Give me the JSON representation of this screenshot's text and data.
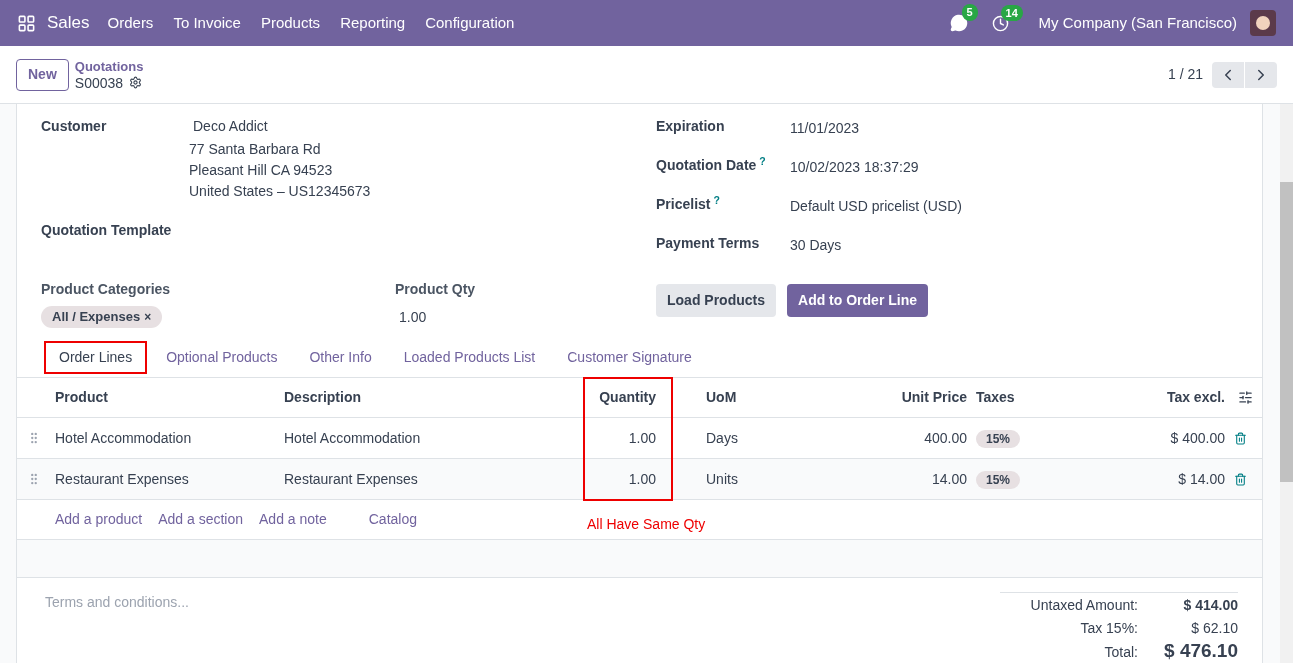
{
  "navbar": {
    "app": "Sales",
    "menu": [
      "Orders",
      "To Invoice",
      "Products",
      "Reporting",
      "Configuration"
    ],
    "messages_count": "5",
    "activities_count": "14",
    "company": "My Company (San Francisco)"
  },
  "control_panel": {
    "new_button": "New",
    "breadcrumb": "Quotations",
    "record": "S00038",
    "pager": "1 / 21"
  },
  "form": {
    "left_fields": [
      {
        "label": "Customer",
        "lines": [
          "Deco Addict",
          "77 Santa Barbara Rd",
          "Pleasant Hill CA 94523",
          "United States – US12345673"
        ]
      },
      {
        "label": "Quotation Template"
      }
    ],
    "right_fields": [
      {
        "label": "Expiration",
        "value": "11/01/2023"
      },
      {
        "label": "Quotation Date",
        "help": "?",
        "value": "10/02/2023 18:37:29"
      },
      {
        "label": "Pricelist",
        "help": "?",
        "value": "Default USD pricelist (USD)"
      },
      {
        "label": "Payment Terms",
        "value": "30 Days"
      }
    ],
    "product_categories": {
      "label": "Product Categories",
      "tags": [
        {
          "label": "All / Expenses",
          "remove": "×"
        }
      ]
    },
    "product_qty": {
      "label": "Product Qty",
      "value": "1.00"
    },
    "buttons": [
      {
        "label": "Load Products",
        "kind": "secondary"
      },
      {
        "label": "Add to Order Line",
        "kind": "primary"
      }
    ]
  },
  "tabs": [
    {
      "label": "Order Lines",
      "selected": true
    },
    {
      "label": "Optional Products",
      "selected": false
    },
    {
      "label": "Other Info",
      "selected": false
    },
    {
      "label": "Loaded Products List",
      "selected": false
    },
    {
      "label": "Customer Signature",
      "selected": false
    }
  ],
  "table": {
    "columns": [
      "Product",
      "Description",
      "Quantity",
      "UoM",
      "Unit Price",
      "Taxes",
      "Tax excl."
    ],
    "rows": [
      {
        "product": "Hotel Accommodation",
        "description": "Hotel Accommodation",
        "quantity": "1.00",
        "uom": "Days",
        "unit_price": "400.00",
        "tax": "15%",
        "subtotal": "$ 400.00"
      },
      {
        "product": "Restaurant Expenses",
        "description": "Restaurant Expenses",
        "quantity": "1.00",
        "uom": "Units",
        "unit_price": "14.00",
        "tax": "15%",
        "subtotal": "$ 14.00"
      }
    ],
    "add_links": [
      "Add a product",
      "Add a section",
      "Add a note",
      "Catalog"
    ]
  },
  "annotation": "All Have Same Qty",
  "footer": {
    "terms_placeholder": "Terms and conditions...",
    "totals": [
      {
        "label": "Untaxed Amount:",
        "value": "$ 414.00",
        "kind": "bold"
      },
      {
        "label": "Tax 15%:",
        "value": "$ 62.10",
        "kind": "normal"
      },
      {
        "label": "Total:",
        "value": "$ 476.10",
        "kind": "total"
      }
    ]
  }
}
